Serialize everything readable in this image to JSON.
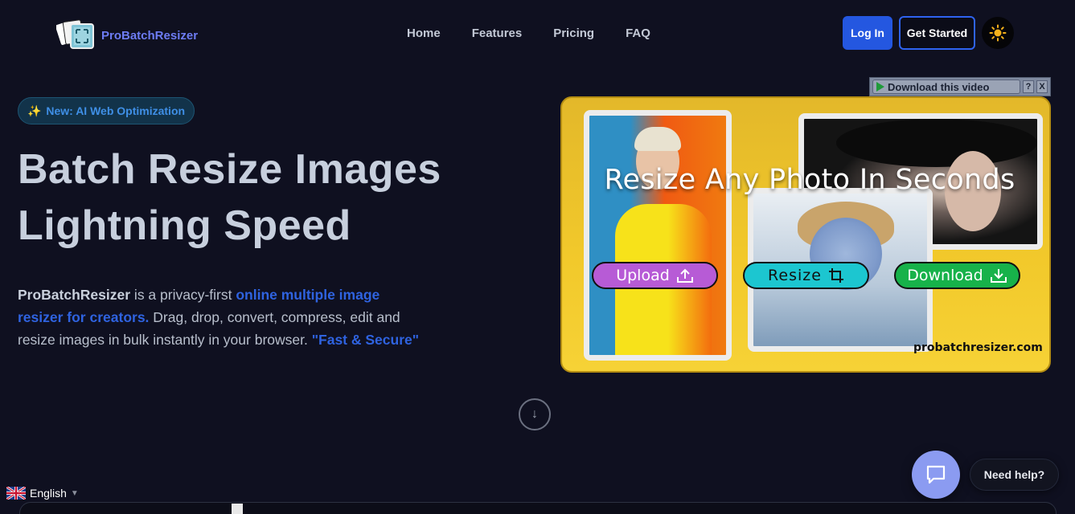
{
  "header": {
    "brand": "ProBatchResizer",
    "nav": [
      "Home",
      "Features",
      "Pricing",
      "FAQ"
    ],
    "login_label": "Log In",
    "get_started_label": "Get Started",
    "theme_icon": "sun-icon"
  },
  "hero": {
    "badge": "New: AI Web Optimization",
    "badge_icon": "sparkles-icon",
    "title_line1": "Batch Resize Images",
    "title_line2": "Lightning Speed",
    "desc_brand": "ProBatchResizer",
    "desc_part1": " is a privacy-first ",
    "desc_highlight": "online multiple image resizer for creators.",
    "desc_part2": " Drag, drop, convert, compress, edit and resize images in bulk instantly in your browser. ",
    "desc_quote": "\"Fast & Secure\"",
    "scroll_icon": "arrow-down-icon"
  },
  "video_overlay": {
    "download_label": "Download this video",
    "help": "?",
    "close": "X"
  },
  "promo": {
    "title": "Resize Any Photo In Seconds",
    "upload_label": "Upload",
    "resize_label": "Resize",
    "download_label": "Download",
    "url": "probatchresizer.com"
  },
  "chat": {
    "help_label": "Need help?",
    "chat_icon": "chat-bubble-icon"
  },
  "language": {
    "current": "English",
    "flag": "uk-flag-icon"
  },
  "colors": {
    "background": "#0f1020",
    "accent": "#2457e0",
    "brand": "#6d7cf3",
    "promo_yellow": "#f2c92b"
  }
}
